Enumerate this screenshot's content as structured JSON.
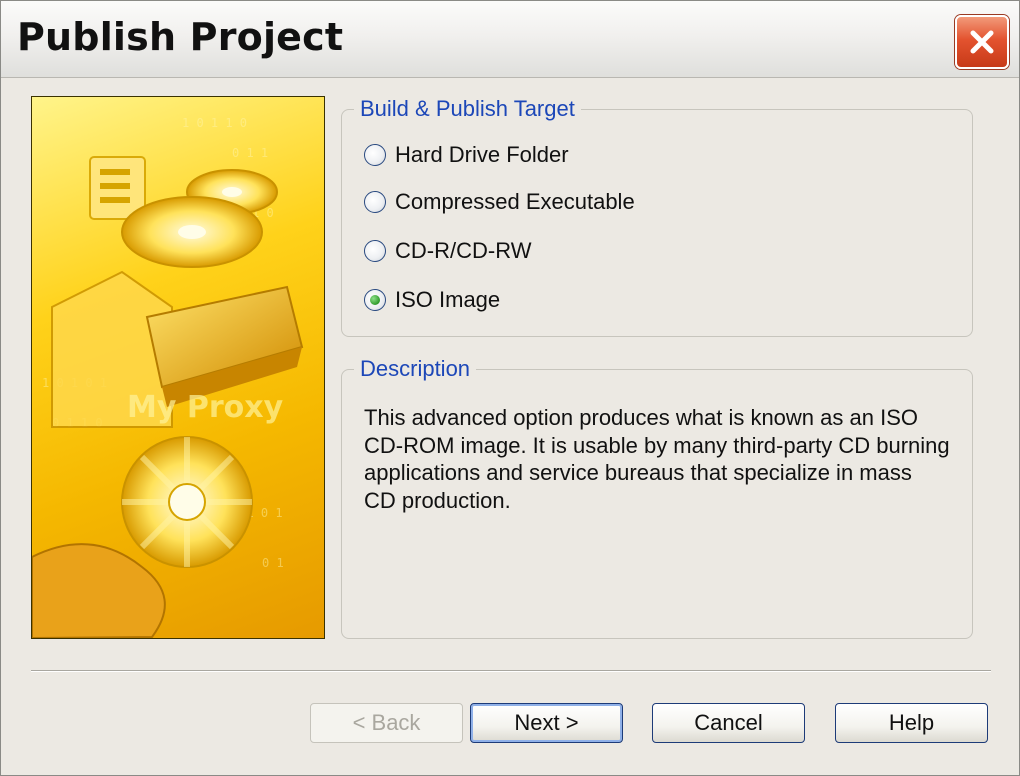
{
  "window": {
    "title": "Publish Project"
  },
  "target_group": {
    "legend": "Build & Publish Target",
    "options": [
      {
        "label": "Hard Drive Folder",
        "selected": false
      },
      {
        "label": "Compressed Executable",
        "selected": false
      },
      {
        "label": "CD-R/CD-RW",
        "selected": false
      },
      {
        "label": "ISO Image",
        "selected": true
      }
    ]
  },
  "description_group": {
    "legend": "Description",
    "lines": [
      "This advanced option produces what is known as an ISO",
      "CD-ROM image. It is usable by many third-party CD burning",
      "applications and service bureaus that specialize in mass",
      "CD production."
    ]
  },
  "buttons": {
    "back": "< Back",
    "next": "Next >",
    "cancel": "Cancel",
    "help": "Help"
  },
  "colors": {
    "legend_text": "#1c47b8",
    "radio_selected": "#2f9a2a",
    "close_button": "#e3532f",
    "banner_gold": "#ffd21a"
  },
  "icons": {
    "close": "close-icon",
    "banner": "cd-publish-illustration"
  }
}
